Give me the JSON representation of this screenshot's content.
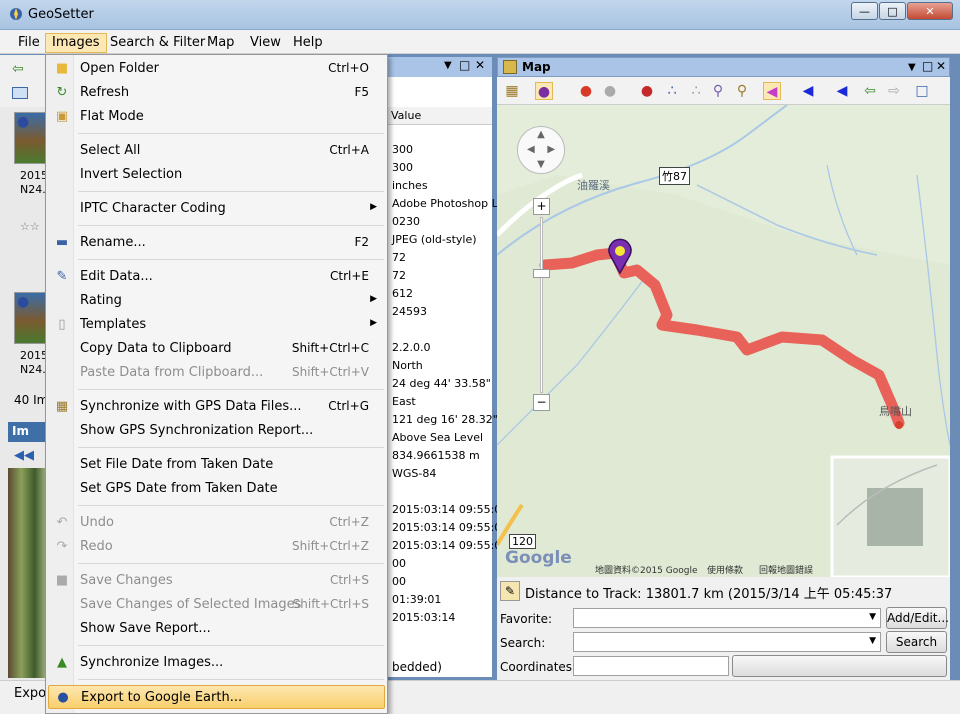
{
  "window": {
    "title": "GeoSetter"
  },
  "menubar": [
    "File",
    "Images",
    "Search & Filter",
    "Map",
    "View",
    "Help"
  ],
  "images_menu": {
    "items": [
      {
        "label": "Open Folder",
        "shortcut": "Ctrl+O",
        "icon": "folder-icon"
      },
      {
        "label": "Refresh",
        "shortcut": "F5",
        "icon": "refresh-icon"
      },
      {
        "label": "Flat Mode",
        "shortcut": "",
        "icon": "flat-mode-icon"
      },
      {
        "label": "Select All",
        "shortcut": "Ctrl+A"
      },
      {
        "label": "Invert Selection",
        "shortcut": ""
      },
      {
        "label": "IPTC Character Coding",
        "shortcut": "",
        "submenu": true
      },
      {
        "label": "Rename...",
        "shortcut": "F2",
        "icon": "rename-icon"
      },
      {
        "label": "Edit Data...",
        "shortcut": "Ctrl+E",
        "icon": "edit-data-icon"
      },
      {
        "label": "Rating",
        "shortcut": "",
        "submenu": true
      },
      {
        "label": "Templates",
        "shortcut": "",
        "submenu": true,
        "icon": "templates-icon"
      },
      {
        "label": "Copy Data to Clipboard",
        "shortcut": "Shift+Ctrl+C"
      },
      {
        "label": "Paste Data from Clipboard...",
        "shortcut": "Shift+Ctrl+V",
        "disabled": true
      },
      {
        "label": "Synchronize with GPS Data Files...",
        "shortcut": "Ctrl+G",
        "icon": "gps-sync-icon"
      },
      {
        "label": "Show GPS Synchronization Report...",
        "shortcut": ""
      },
      {
        "label": "Set File Date from Taken Date",
        "shortcut": ""
      },
      {
        "label": "Set GPS Date from Taken Date",
        "shortcut": ""
      },
      {
        "label": "Undo",
        "shortcut": "Ctrl+Z",
        "disabled": true,
        "icon": "undo-icon"
      },
      {
        "label": "Redo",
        "shortcut": "Shift+Ctrl+Z",
        "disabled": true,
        "icon": "redo-icon"
      },
      {
        "label": "Save Changes",
        "shortcut": "Ctrl+S",
        "disabled": true,
        "icon": "save-icon"
      },
      {
        "label": "Save Changes of Selected Images",
        "shortcut": "Shift+Ctrl+S",
        "disabled": true
      },
      {
        "label": "Show Save Report...",
        "shortcut": ""
      },
      {
        "label": "Synchronize Images...",
        "shortcut": "",
        "icon": "sync-images-icon"
      },
      {
        "label": "Export to Google Earth...",
        "shortcut": "",
        "icon": "google-earth-icon",
        "highlighted": true
      }
    ]
  },
  "details": {
    "column_header": "Value",
    "values": [
      "300",
      "300",
      "inches",
      "Adobe Photoshop Li",
      "0230",
      "JPEG (old-style)",
      "72",
      "72",
      "612",
      "24593",
      "",
      "2.2.0.0",
      "North",
      "24 deg 44' 33.58\"",
      "East",
      "121 deg 16' 28.32\"",
      "Above Sea Level",
      "834.9661538 m",
      "WGS-84",
      "",
      "2015:03:14 09:55:0",
      "2015:03:14 09:55:0",
      "2015:03:14 09:55:0",
      "00",
      "00",
      "01:39:01",
      "2015:03:14"
    ],
    "footer": "bedded)"
  },
  "left_panel": {
    "thumb1_lines": [
      "2015",
      "N24."
    ],
    "thumb2_lines": [
      "2015",
      "N24."
    ],
    "count": "40 Im",
    "image_panel_title": "Im",
    "status": "Expo"
  },
  "map_panel": {
    "title": "Map",
    "labels": {
      "road_1": "竹87",
      "road_2": "120",
      "river": "油羅溪",
      "peak": "鳥嘴山",
      "copyright": "地圖資料©2015 Google",
      "terms": "使用條款",
      "report": "回報地圖錯誤",
      "brand": "Google"
    },
    "distance": "Distance to Track: 13801.7 km (2015/3/14 上午 05:45:37",
    "favorite_label": "Favorite:",
    "search_label": "Search:",
    "coordinates_label": "Coordinates:",
    "add_edit_button": "Add/Edit...",
    "search_button": "Search",
    "track_color": "#e8625a"
  }
}
